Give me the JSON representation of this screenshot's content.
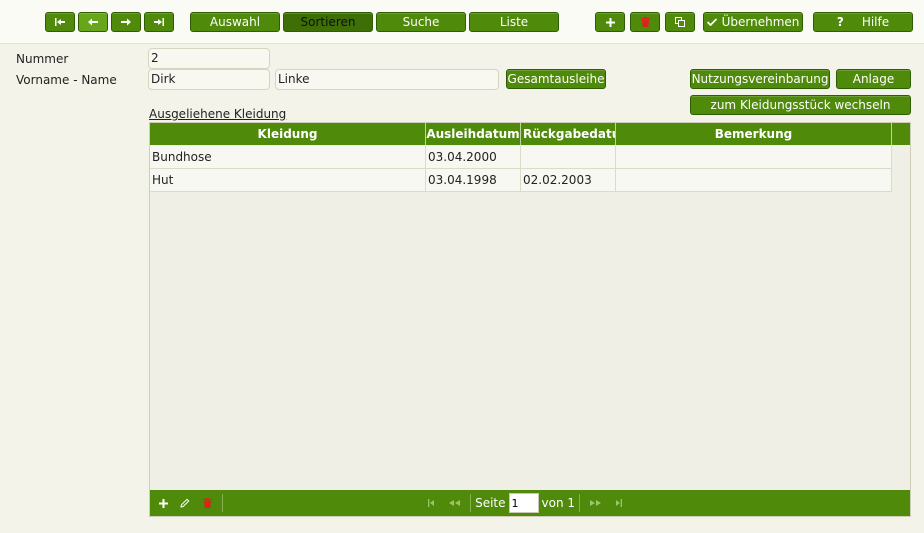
{
  "toolbar": {
    "auswahl": "Auswahl",
    "sortieren": "Sortieren",
    "suche": "Suche",
    "liste": "Liste",
    "uebernehmen": "Übernehmen",
    "hilfe": "Hilfe"
  },
  "form": {
    "nummer_label": "Nummer",
    "nummer_value": "2",
    "name_label": "Vorname - Name",
    "vorname_value": "Dirk",
    "nachname_value": "Linke",
    "gesamtausleihe": "Gesamtausleihe",
    "nutzungsvereinbarung": "Nutzungsvereinbarung",
    "anlage": "Anlage",
    "kleidungsstueck_wechseln": "zum Kleidungsstück wechseln"
  },
  "grid": {
    "title": "Ausgeliehene Kleidung",
    "columns": [
      "Kleidung",
      "Ausleihdatum",
      "Rückgabedatum",
      "Bemerkung"
    ],
    "rows": [
      [
        "Bundhose",
        "03.04.2000",
        "",
        ""
      ],
      [
        "Hut",
        "03.04.1998",
        "02.02.2003",
        ""
      ]
    ]
  },
  "pager": {
    "seite_label": "Seite",
    "page_value": "1",
    "von_label": "von 1"
  },
  "colors": {
    "accent": "#4f8a0b",
    "delete": "#d9251c"
  }
}
